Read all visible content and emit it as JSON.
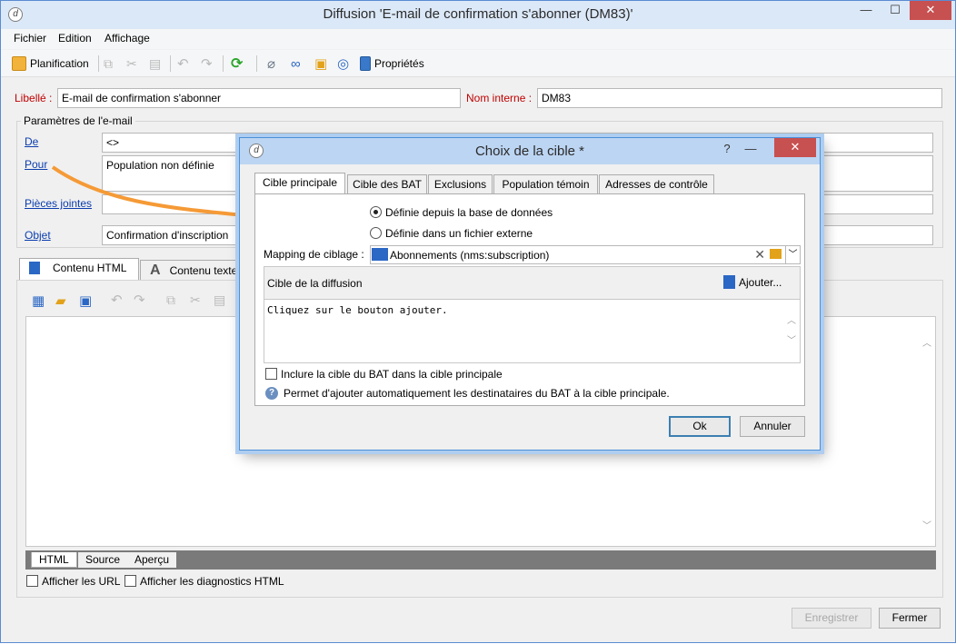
{
  "window": {
    "title": "Diffusion 'E-mail de confirmation s'abonner (DM83)'",
    "controls": {
      "minimize": "—",
      "maximize": "☐",
      "close": "✕"
    }
  },
  "menu": [
    "Fichier",
    "Edition",
    "Affichage"
  ],
  "toolbar": {
    "planification": "Planification",
    "proprietes": "Propriétés"
  },
  "form": {
    "libelle_label": "Libellé :",
    "libelle_value": "E-mail de confirmation s'abonner",
    "nom_interne_label": "Nom interne :",
    "nom_interne_value": "DM83",
    "group_title": "Paramètres de l'e-mail",
    "de_label": "De",
    "de_value": "<>",
    "pour_label": "Pour",
    "pour_value": "Population non définie",
    "pj_label": "Pièces jointes",
    "pj_value": "",
    "objet_label": "Objet",
    "objet_value": "Confirmation d'inscription"
  },
  "content_tabs": {
    "html": "Contenu HTML",
    "texte": "Contenu texte"
  },
  "editor_tabs": [
    "HTML",
    "Source",
    "Aperçu"
  ],
  "options": {
    "afficher_url": "Afficher les URL",
    "afficher_diag": "Afficher les diagnostics HTML"
  },
  "footer": {
    "enregistrer": "Enregistrer",
    "fermer": "Fermer"
  },
  "dialog": {
    "title": "Choix de la cible *",
    "controls": {
      "help": "?",
      "minimize": "—",
      "close": "✕"
    },
    "tabs": [
      "Cible principale",
      "Cible des BAT",
      "Exclusions",
      "Population témoin",
      "Adresses de contrôle"
    ],
    "radio_db": "Définie depuis la base de données",
    "radio_file": "Définie dans un fichier externe",
    "mapping_label": "Mapping de ciblage :",
    "mapping_value": "Abonnements (nms:subscription)",
    "cible_label": "Cible de la diffusion",
    "ajouter": "Ajouter...",
    "placeholder": "Cliquez sur le bouton ajouter.",
    "include_bat": "Inclure la cible du BAT dans la cible principale",
    "help_text": "Permet d'ajouter automatiquement les destinataires du BAT à la cible principale.",
    "ok": "Ok",
    "annuler": "Annuler"
  },
  "colors": {
    "accent": "#f59a36",
    "link": "#0b3dae",
    "required": "#c00000"
  }
}
